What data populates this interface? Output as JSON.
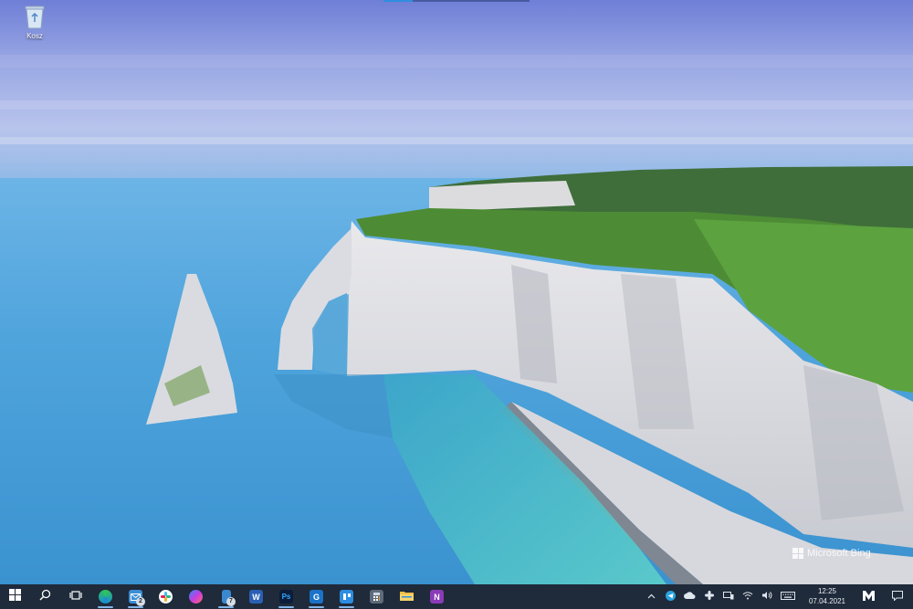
{
  "desktop": {
    "recycle_bin_label": "Kosz"
  },
  "wallpaper": {
    "watermark_text": "Microsoft Bing"
  },
  "taskbar": {
    "pinned": [
      {
        "name": "start-button",
        "icon": "windows-logo-icon",
        "color": "#ffffff"
      },
      {
        "name": "search-button",
        "icon": "search-icon",
        "color": "#ffffff"
      },
      {
        "name": "task-view-button",
        "icon": "task-view-icon",
        "color": "#ffffff"
      },
      {
        "name": "edge-button",
        "icon": "edge-icon",
        "color": "#2aa7e0",
        "running": true
      },
      {
        "name": "mail-button",
        "icon": "mail-icon",
        "color": "#3b8ed4",
        "running": true,
        "badge": "2"
      },
      {
        "name": "slack-button",
        "icon": "slack-icon",
        "color": "#ffffff"
      },
      {
        "name": "messenger-button",
        "icon": "messenger-icon",
        "color": "#a04de8"
      },
      {
        "name": "phone-button",
        "icon": "phone-icon",
        "color": "#3a89d0",
        "running": true,
        "badge": "7"
      },
      {
        "name": "word-button",
        "icon": "word-icon",
        "color": "#2b5fb4",
        "glyph": "W"
      },
      {
        "name": "photoshop-button",
        "icon": "photoshop-icon",
        "color": "#0b1d3a",
        "glyph": "Ps",
        "running": true
      },
      {
        "name": "outlook-button",
        "icon": "outlook-icon",
        "color": "#1a73c8",
        "glyph": "G",
        "running": true
      },
      {
        "name": "trello-button",
        "icon": "trello-icon",
        "color": "#2d8de0",
        "running": true
      },
      {
        "name": "calculator-button",
        "icon": "calculator-icon",
        "color": "#5d6b7a"
      },
      {
        "name": "file-explorer-button",
        "icon": "folder-icon",
        "color": "#f2c04a"
      },
      {
        "name": "onenote-button",
        "icon": "onenote-icon",
        "color": "#8a3bb8",
        "glyph": "N"
      }
    ],
    "clock": {
      "time": "12:25",
      "date": "07.04.2021"
    }
  }
}
